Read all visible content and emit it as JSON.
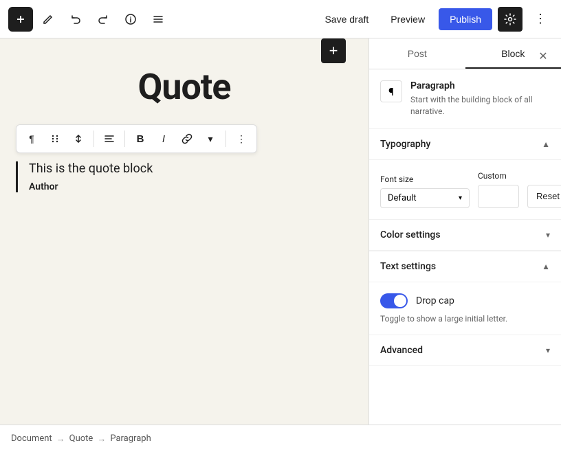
{
  "header": {
    "save_draft_label": "Save draft",
    "preview_label": "Preview",
    "publish_label": "Publish"
  },
  "block_toolbar": {
    "type_icon": "¶",
    "drag_icon": "⠿",
    "move_icon": "⌃",
    "align_icon": "≡",
    "bold_icon": "B",
    "italic_icon": "I",
    "link_icon": "🔗",
    "more_icon": "⋯"
  },
  "editor": {
    "title": "Quote",
    "quote_text": "This is the quote block",
    "quote_author": "Author"
  },
  "sidebar": {
    "tab_post": "Post",
    "tab_block": "Block",
    "block_name": "Paragraph",
    "block_description": "Start with the building block of all narrative."
  },
  "typography": {
    "section_label": "Typography",
    "font_size_label": "Font size",
    "custom_label": "Custom",
    "font_size_value": "Default",
    "reset_label": "Reset"
  },
  "color_settings": {
    "section_label": "Color settings"
  },
  "text_settings": {
    "section_label": "Text settings",
    "drop_cap_label": "Drop cap",
    "drop_cap_description": "Toggle to show a large initial letter."
  },
  "advanced": {
    "section_label": "Advanced"
  },
  "breadcrumb": {
    "items": [
      "Document",
      "Quote",
      "Paragraph"
    ]
  }
}
